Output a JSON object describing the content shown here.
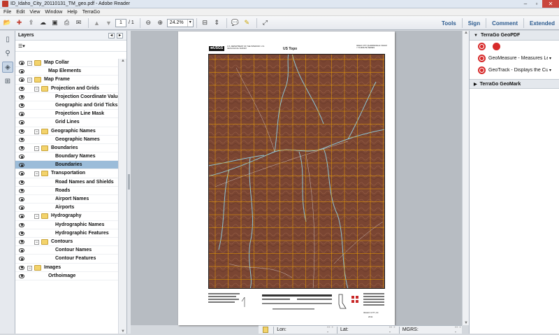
{
  "window": {
    "title": "ID_Idaho_City_20110131_TM_geo.pdf - Adobe Reader"
  },
  "menu": [
    "File",
    "Edit",
    "View",
    "Window",
    "Help",
    "TerraGo"
  ],
  "toolbar": {
    "page_current": "1",
    "page_total": "/ 1",
    "zoom": "24.2%"
  },
  "right_links": [
    "Tools",
    "Sign",
    "Comment",
    "Extended"
  ],
  "layers_panel": {
    "title": "Layers",
    "items": [
      {
        "label": "Map Collar",
        "level": 0,
        "folder": true,
        "expand": "−",
        "selected": false
      },
      {
        "label": "Map Elements",
        "level": 1,
        "folder": false,
        "selected": false
      },
      {
        "label": "Map Frame",
        "level": 0,
        "folder": true,
        "expand": "−",
        "selected": false
      },
      {
        "label": "Projection and Grids",
        "level": 1,
        "folder": true,
        "expand": "−",
        "selected": false
      },
      {
        "label": "Projection Coordinate Values",
        "level": 2,
        "folder": false,
        "selected": false
      },
      {
        "label": "Geographic and Grid Ticks",
        "level": 2,
        "folder": false,
        "selected": false
      },
      {
        "label": "Projection Line Mask",
        "level": 2,
        "folder": false,
        "selected": false
      },
      {
        "label": "Grid Lines",
        "level": 2,
        "folder": false,
        "selected": false
      },
      {
        "label": "Geographic Names",
        "level": 1,
        "folder": true,
        "expand": "−",
        "selected": false
      },
      {
        "label": "Geographic Names",
        "level": 2,
        "folder": false,
        "selected": false
      },
      {
        "label": "Boundaries",
        "level": 1,
        "folder": true,
        "expand": "−",
        "selected": false
      },
      {
        "label": "Boundary Names",
        "level": 2,
        "folder": false,
        "selected": false
      },
      {
        "label": "Boundaries",
        "level": 2,
        "folder": false,
        "selected": true
      },
      {
        "label": "Transportation",
        "level": 1,
        "folder": true,
        "expand": "−",
        "selected": false
      },
      {
        "label": "Road Names and Shields",
        "level": 2,
        "folder": false,
        "selected": false
      },
      {
        "label": "Roads",
        "level": 2,
        "folder": false,
        "selected": false
      },
      {
        "label": "Airport Names",
        "level": 2,
        "folder": false,
        "selected": false
      },
      {
        "label": "Airports",
        "level": 2,
        "folder": false,
        "selected": false
      },
      {
        "label": "Hydrography",
        "level": 1,
        "folder": true,
        "expand": "−",
        "selected": false
      },
      {
        "label": "Hydrographic Names",
        "level": 2,
        "folder": false,
        "selected": false
      },
      {
        "label": "Hydrographic Features",
        "level": 2,
        "folder": false,
        "selected": false
      },
      {
        "label": "Contours",
        "level": 1,
        "folder": true,
        "expand": "−",
        "selected": false
      },
      {
        "label": "Contour Names",
        "level": 2,
        "folder": false,
        "selected": false
      },
      {
        "label": "Contour Features",
        "level": 2,
        "folder": false,
        "selected": false
      },
      {
        "label": "Images",
        "level": 0,
        "folder": true,
        "expand": "−",
        "selected": false
      },
      {
        "label": "Orthoimage",
        "level": 1,
        "folder": false,
        "selected": false
      }
    ]
  },
  "status": {
    "lon_label": "Lon:",
    "lon_value": "-- --",
    "lat_label": "Lat:",
    "lat_value": "-- --",
    "mgrs_label": "MGRS:",
    "mgrs_value": "-- --"
  },
  "right_panel": {
    "section1": "TerraGo GeoPDF",
    "tools": [
      {
        "label": "GeoMeasure - Measures Le...",
        "icon": "geomeasure-icon"
      },
      {
        "label": "GeoTrack - Displays the Cu...",
        "icon": "geotrack-icon"
      }
    ],
    "section2": "TerraGo GeoMark"
  },
  "map": {
    "header_left": "U.S. DEPARTMENT OF THE INTERIOR / U.S. GEOLOGICAL SURVEY",
    "header_center": "US Topo",
    "header_right": "IDAHO CITY QUADRANGLE / IDAHO / 7.5-MINUTE SERIES",
    "footer_right": "IDAHO CITY, ID",
    "footer_year": "2011"
  },
  "colors": {
    "accent": "#2c5b8f",
    "selection": "#9bbcd9",
    "terrain": "#7a4532",
    "grid": "#f2a300",
    "water": "#8fd3e6"
  }
}
